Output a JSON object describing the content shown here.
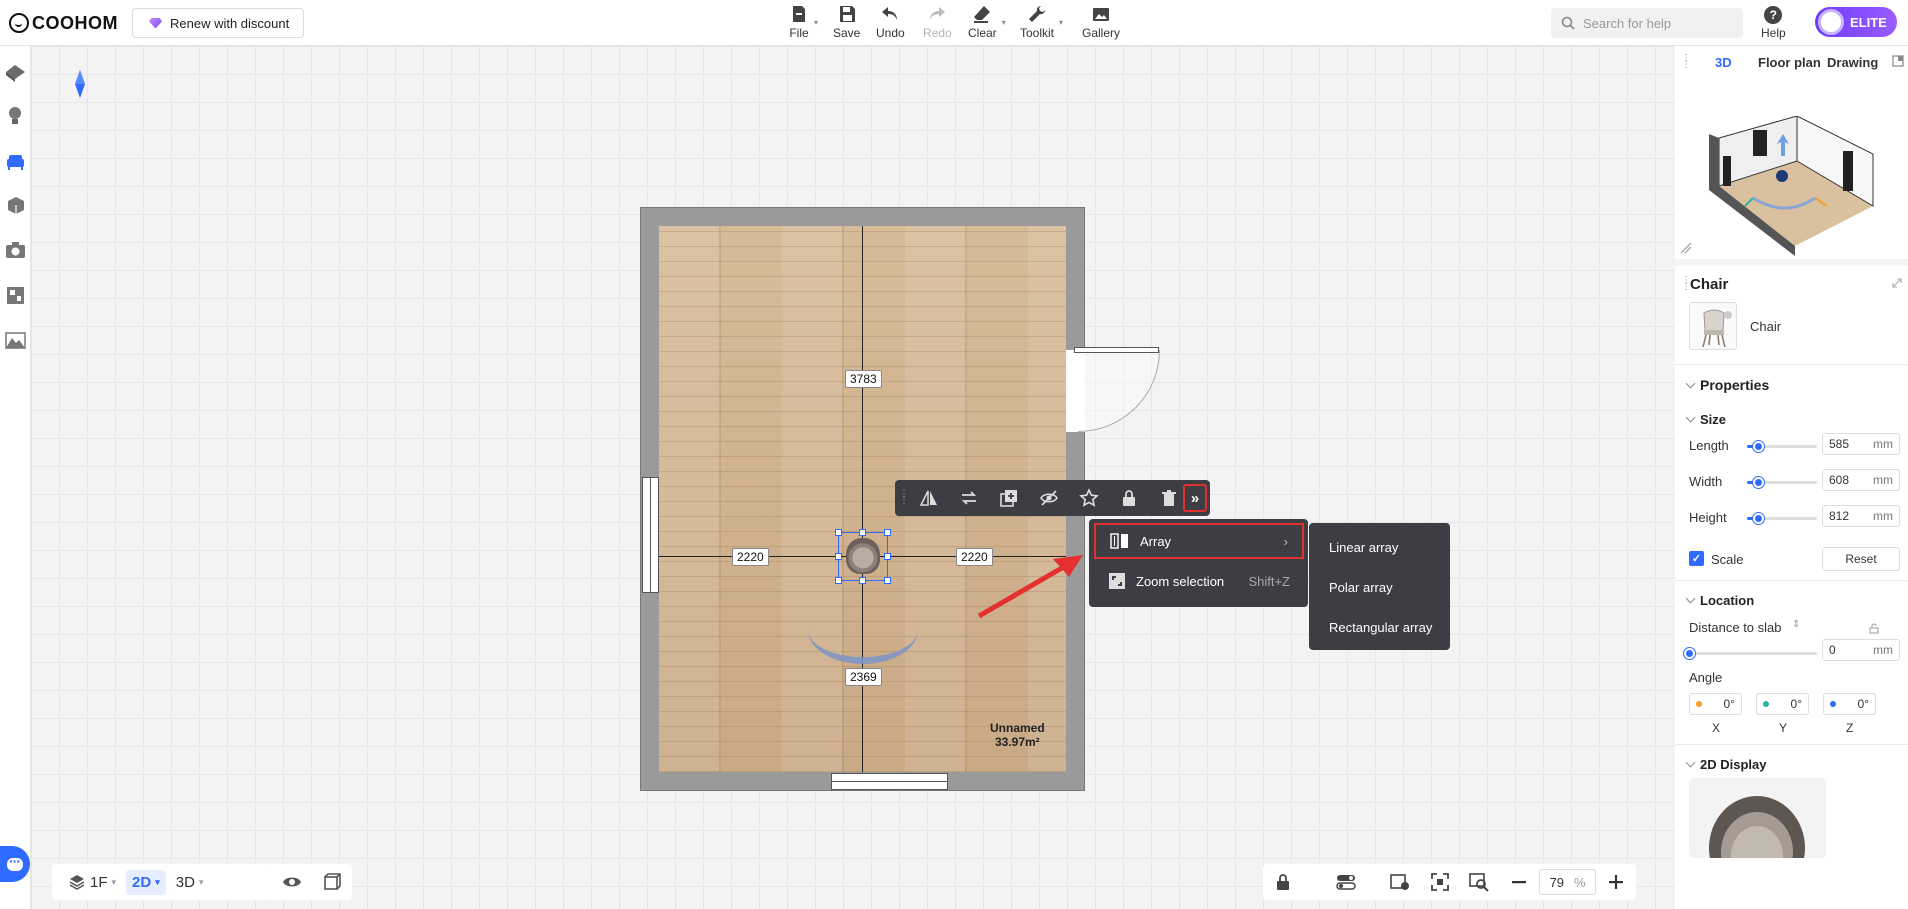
{
  "brand": {
    "logo_text": "COOHOM",
    "renew_label": "Renew with discount"
  },
  "toolbar": {
    "file": "File",
    "save": "Save",
    "undo": "Undo",
    "redo": "Redo",
    "clear": "Clear",
    "toolkit": "Toolkit",
    "gallery": "Gallery"
  },
  "search": {
    "placeholder": "Search for help"
  },
  "help": {
    "label": "Help"
  },
  "plan": {
    "label": "ELITE"
  },
  "canvas": {
    "dims": {
      "top": "3783",
      "left": "2220",
      "right": "2220",
      "bottom": "2369"
    },
    "room_name": "Unnamed",
    "room_area": "33.97m²"
  },
  "context_menu": {
    "items": [
      {
        "label": "Array",
        "has_submenu": true
      },
      {
        "label": "Zoom selection",
        "shortcut": "Shift+Z"
      }
    ],
    "submenu": [
      "Linear array",
      "Polar array",
      "Rectangular array"
    ]
  },
  "bottom": {
    "floor": "1F",
    "mode_2d": "2D",
    "mode_3d": "3D",
    "zoom_value": "79",
    "zoom_unit": "%"
  },
  "right_panel": {
    "view_tabs": [
      "3D",
      "Floor plan",
      "Drawing"
    ],
    "active_tab": "3D",
    "object_title": "Chair",
    "object_name": "Chair",
    "properties_label": "Properties",
    "size_label": "Size",
    "length": {
      "label": "Length",
      "value": "585",
      "unit": "mm",
      "fill": 0.15
    },
    "width": {
      "label": "Width",
      "value": "608",
      "unit": "mm",
      "fill": 0.15
    },
    "height": {
      "label": "Height",
      "value": "812",
      "unit": "mm",
      "fill": 0.15
    },
    "scale_label": "Scale",
    "reset_label": "Reset",
    "location_label": "Location",
    "distance_label": "Distance to slab",
    "distance": {
      "value": "0",
      "unit": "mm"
    },
    "angle_label": "Angle",
    "angles": [
      {
        "axis": "X",
        "value": "0°",
        "color": "#f0a030"
      },
      {
        "axis": "Y",
        "value": "0°",
        "color": "#2bb3a0"
      },
      {
        "axis": "Z",
        "value": "0°",
        "color": "#2f6bff"
      }
    ],
    "display_label": "2D Display"
  }
}
